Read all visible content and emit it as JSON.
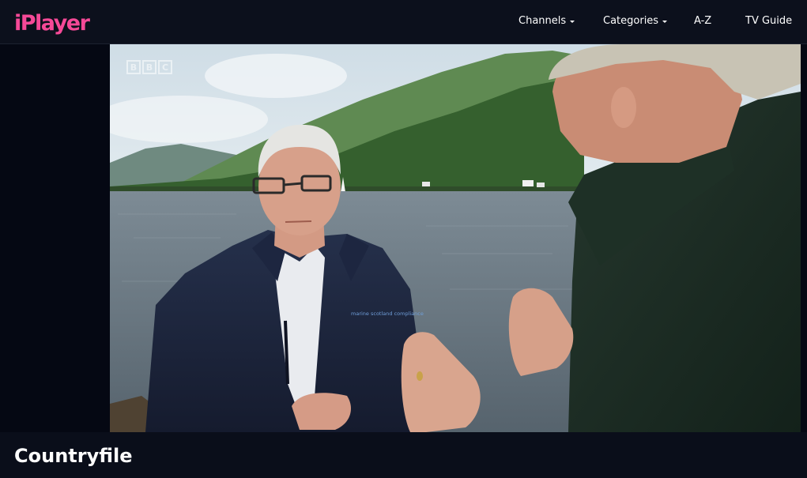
{
  "header": {
    "logo_text": "iPlayer",
    "nav": {
      "channels": "Channels",
      "categories": "Categories",
      "az": "A-Z",
      "tv_guide": "TV Guide"
    }
  },
  "player": {
    "watermark": [
      "B",
      "B",
      "C"
    ],
    "jacket_logo_text": "marine scotland compliance"
  },
  "programme": {
    "title": "Countryfile"
  },
  "colors": {
    "brand_pink": "#f54997",
    "background": "#0a0e1a",
    "text": "#ffffff"
  }
}
